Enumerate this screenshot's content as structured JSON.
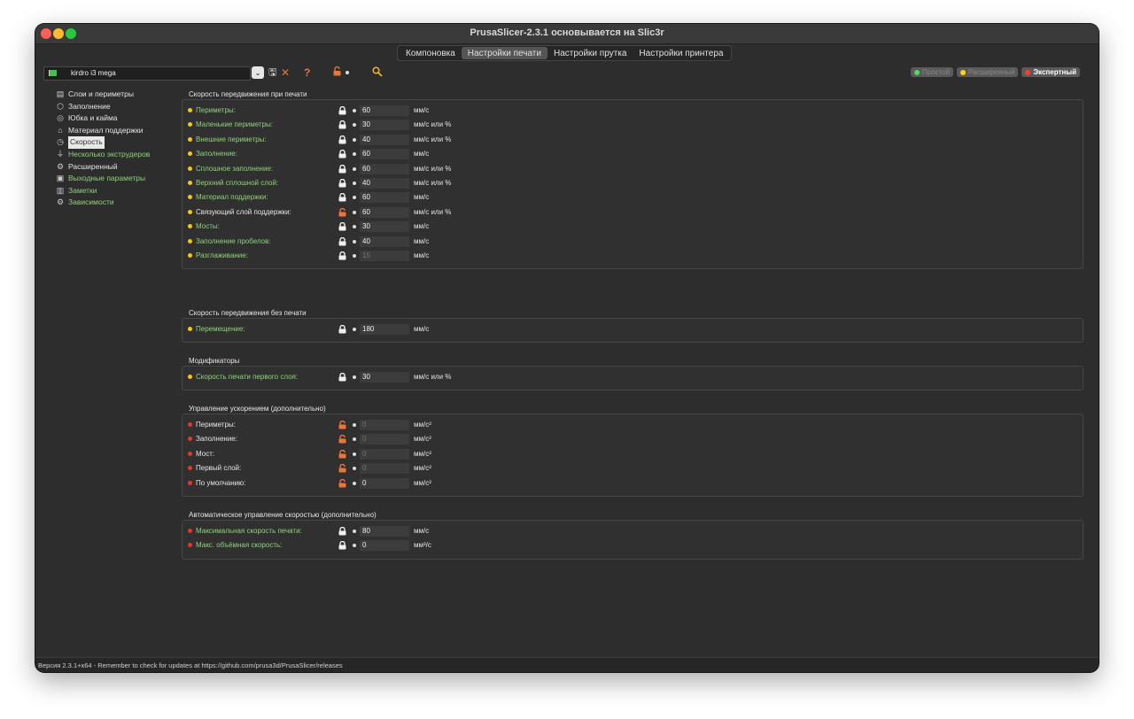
{
  "window": {
    "title": "PrusaSlicer-2.3.1 основывается на Slic3r"
  },
  "tabs": [
    "Компоновка",
    "Настройки печати",
    "Настройки прутка",
    "Настройки принтера"
  ],
  "toolbar": {
    "preset_name": "kirdro i3 mega"
  },
  "modes": [
    {
      "label": "Простой",
      "color": "#4cd964",
      "active": false
    },
    {
      "label": "Расширенный",
      "color": "#ffd60a",
      "active": false
    },
    {
      "label": "Экспертный",
      "color": "#ff3b30",
      "active": true
    }
  ],
  "sidebar": {
    "items": [
      {
        "label": "Слои и периметры",
        "icon": "layers-icon",
        "green": false
      },
      {
        "label": "Заполнение",
        "icon": "infill-icon",
        "green": false
      },
      {
        "label": "Юбка и кайма",
        "icon": "skirt-icon",
        "green": false
      },
      {
        "label": "Материал поддержки",
        "icon": "support-icon",
        "green": false
      },
      {
        "label": "Скорость",
        "icon": "speed-icon",
        "green": false,
        "selected": true
      },
      {
        "label": "Несколько экструдеров",
        "icon": "extruder-icon",
        "green": true
      },
      {
        "label": "Расширенный",
        "icon": "advanced-icon",
        "green": false
      },
      {
        "label": "Выходные параметры",
        "icon": "output-icon",
        "green": true
      },
      {
        "label": "Заметки",
        "icon": "notes-icon",
        "green": true
      },
      {
        "label": "Зависимости",
        "icon": "dependencies-icon",
        "green": true
      }
    ]
  },
  "sections": [
    {
      "title": "Скорость передвижения при печати",
      "rows": [
        {
          "label": "Периметры:",
          "value": "60",
          "unit": "мм/с",
          "level": "yellow",
          "lock": "locked",
          "green": true,
          "dim": false
        },
        {
          "label": "Маленькие периметры:",
          "value": "30",
          "unit": "мм/с или %",
          "level": "yellow",
          "lock": "locked",
          "green": true,
          "dim": false
        },
        {
          "label": "Внешние периметры:",
          "value": "40",
          "unit": "мм/с или %",
          "level": "yellow",
          "lock": "locked",
          "green": true,
          "dim": false
        },
        {
          "label": "Заполнение:",
          "value": "60",
          "unit": "мм/с",
          "level": "yellow",
          "lock": "locked",
          "green": true,
          "dim": false
        },
        {
          "label": "Сплошное заполнение:",
          "value": "60",
          "unit": "мм/с или %",
          "level": "yellow",
          "lock": "locked",
          "green": true,
          "dim": false
        },
        {
          "label": "Верхний сплошной слой:",
          "value": "40",
          "unit": "мм/с или %",
          "level": "yellow",
          "lock": "locked",
          "green": true,
          "dim": false
        },
        {
          "label": "Материал поддержки:",
          "value": "60",
          "unit": "мм/с",
          "level": "yellow",
          "lock": "locked",
          "green": true,
          "dim": false
        },
        {
          "label": "Связующий слой поддержки:",
          "value": "60",
          "unit": "мм/с или %",
          "level": "yellow",
          "lock": "unlocked",
          "green": false,
          "dim": false
        },
        {
          "label": "Мосты:",
          "value": "30",
          "unit": "мм/с",
          "level": "yellow",
          "lock": "locked",
          "green": true,
          "dim": false
        },
        {
          "label": "Заполнение пробелов:",
          "value": "40",
          "unit": "мм/с",
          "level": "yellow",
          "lock": "locked",
          "green": true,
          "dim": false
        },
        {
          "label": "Разглаживание:",
          "value": "15",
          "unit": "мм/с",
          "level": "yellow",
          "lock": "locked",
          "green": true,
          "dim": true
        }
      ]
    },
    {
      "title": "Скорость передвижения без печати",
      "rows": [
        {
          "label": "Перемещение:",
          "value": "180",
          "unit": "мм/с",
          "level": "yellow",
          "lock": "locked",
          "green": true,
          "dim": false
        }
      ]
    },
    {
      "title": "Модификаторы",
      "rows": [
        {
          "label": "Скорость печати первого слоя:",
          "value": "30",
          "unit": "мм/с или %",
          "level": "yellow",
          "lock": "locked",
          "green": true,
          "dim": false
        }
      ]
    },
    {
      "title": "Управление ускорением (дополнительно)",
      "rows": [
        {
          "label": "Периметры:",
          "value": "0",
          "unit": "мм/с²",
          "level": "red",
          "lock": "unlocked",
          "green": false,
          "dim": true
        },
        {
          "label": "Заполнение:",
          "value": "0",
          "unit": "мм/с²",
          "level": "red",
          "lock": "unlocked",
          "green": false,
          "dim": true
        },
        {
          "label": "Мост:",
          "value": "0",
          "unit": "мм/с²",
          "level": "red",
          "lock": "unlocked",
          "green": false,
          "dim": true
        },
        {
          "label": "Первый слой:",
          "value": "0",
          "unit": "мм/с²",
          "level": "red",
          "lock": "unlocked",
          "green": false,
          "dim": true
        },
        {
          "label": "По умолчанию:",
          "value": "0",
          "unit": "мм/с²",
          "level": "red",
          "lock": "unlocked",
          "green": false,
          "dim": false
        }
      ]
    },
    {
      "title": "Автоматическое управление скоростью (дополнительно)",
      "rows": [
        {
          "label": "Максимальная скорость печати:",
          "value": "80",
          "unit": "мм/с",
          "level": "red",
          "lock": "locked",
          "green": true,
          "dim": false
        },
        {
          "label": "Макс. объёмная скорость:",
          "value": "0",
          "unit": "мм³/с",
          "level": "red",
          "lock": "locked",
          "green": true,
          "dim": false
        }
      ]
    }
  ],
  "colors": {
    "yellow": "#f5c518",
    "red": "#e03a2f",
    "green_text": "#8fd27a",
    "orange_lock": "#e8763a"
  },
  "statusbar": {
    "text": "Версия 2.3.1+x64 - Remember to check for updates at https://github.com/prusa3d/PrusaSlicer/releases"
  }
}
